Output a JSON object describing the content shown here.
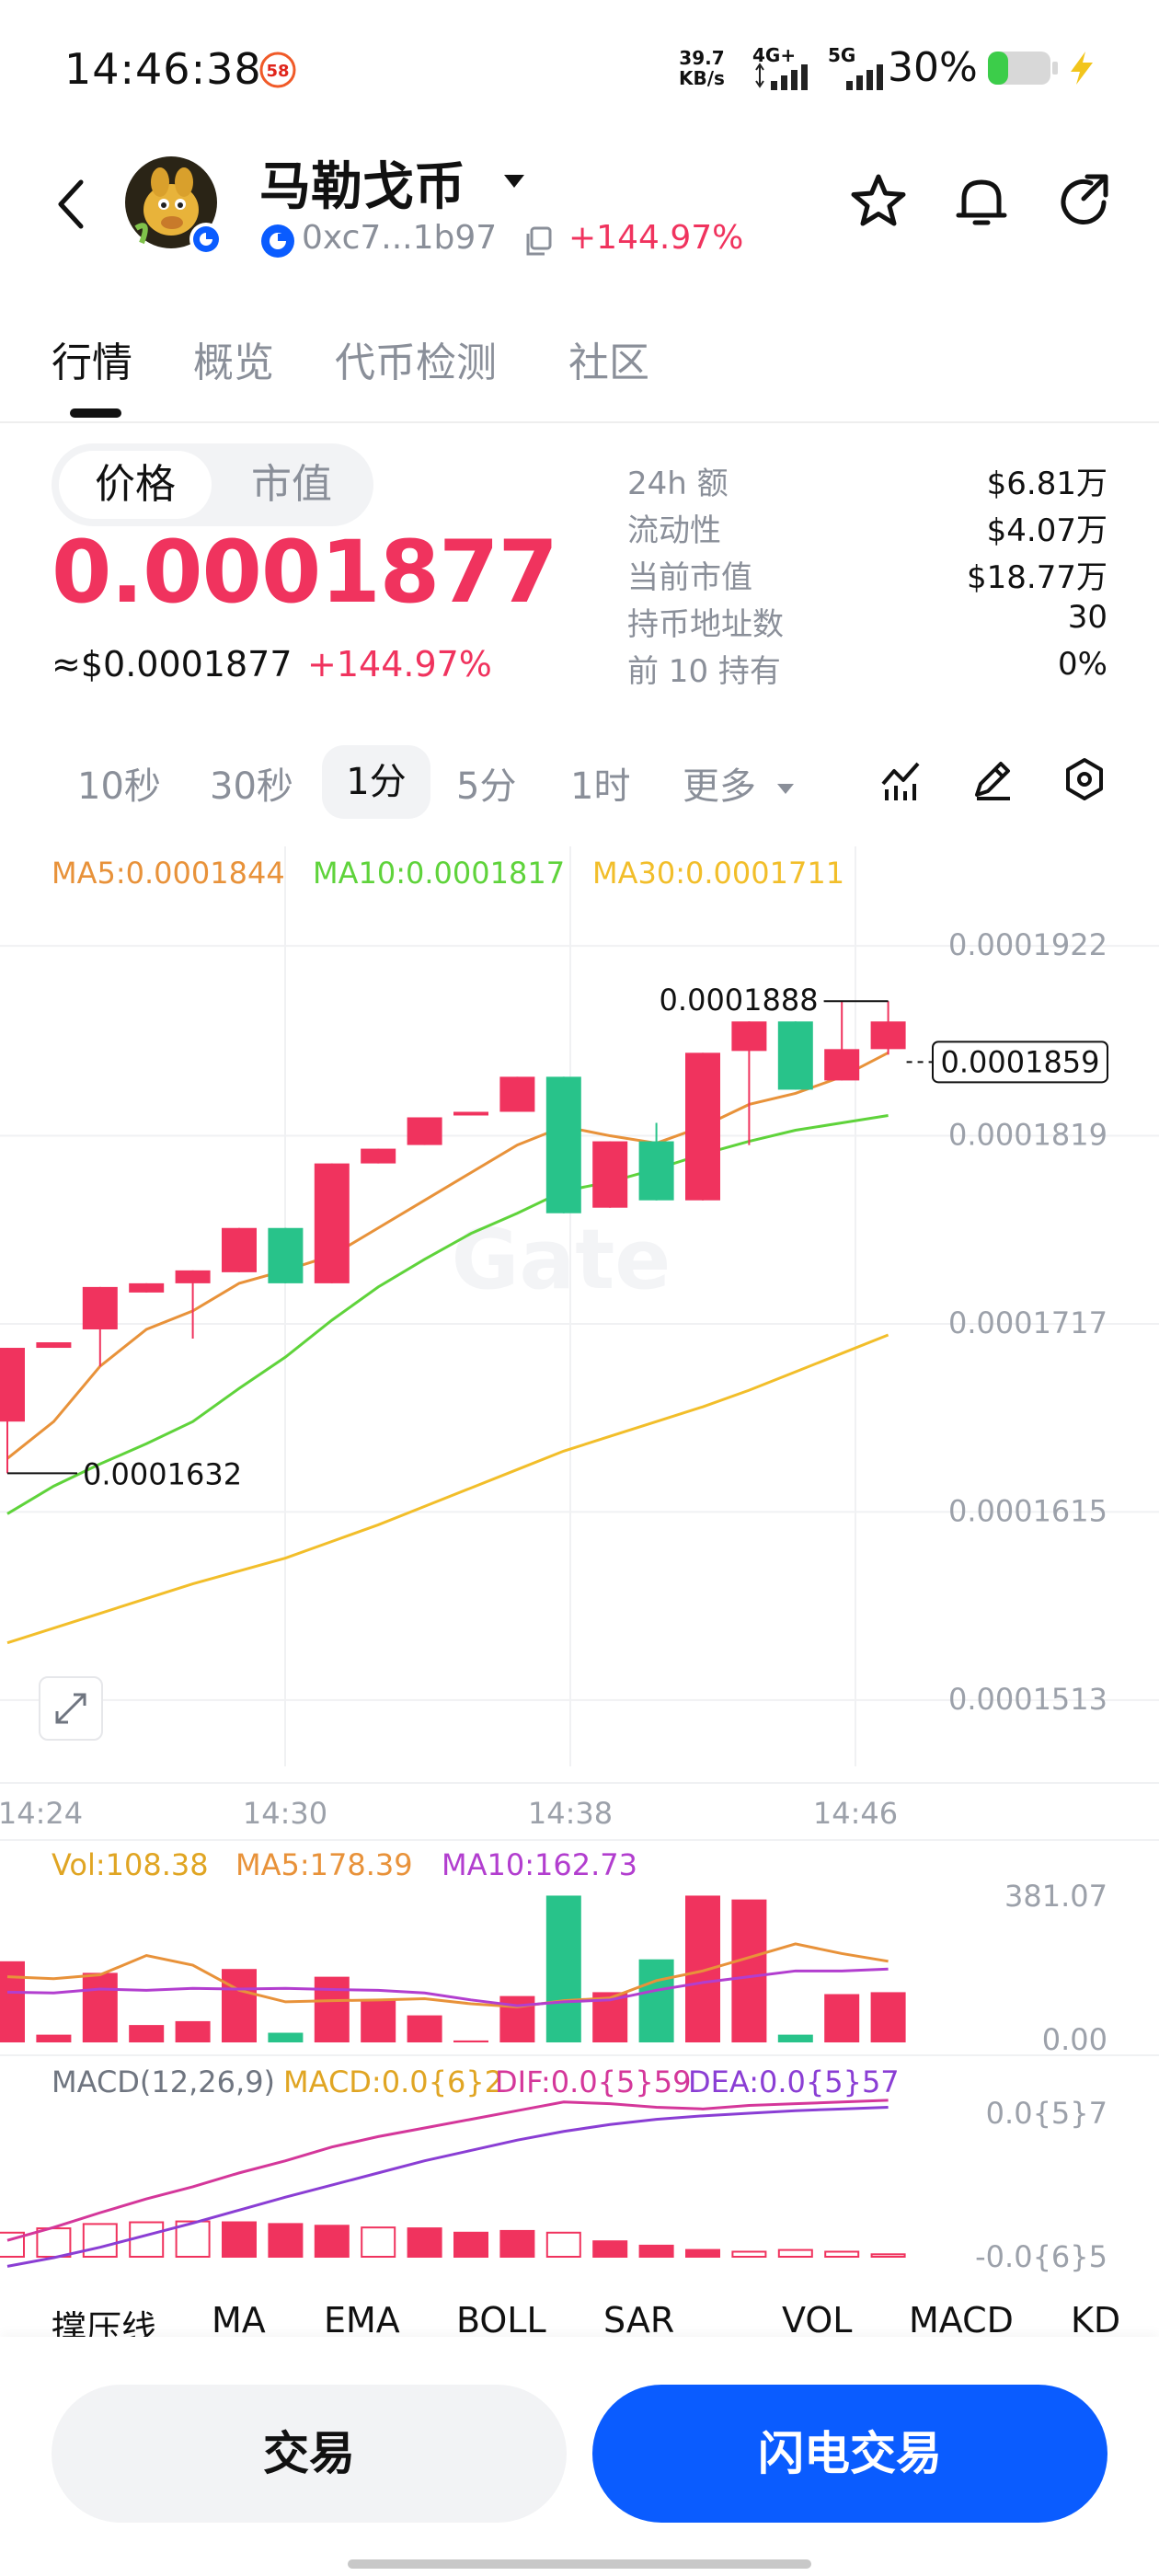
{
  "status_bar": {
    "time": "14:46:38",
    "notification_badge": "58",
    "net_speed_value": "39.7",
    "net_speed_unit": "KB/s",
    "network_1": "4G+",
    "network_2": "5G",
    "battery_percent": "30%"
  },
  "header": {
    "token_name": "马勒戈币",
    "contract_address": "0xc7...1b97",
    "change_percent": "+144.97%"
  },
  "tabs": [
    {
      "label": "行情",
      "active": true
    },
    {
      "label": "概览",
      "active": false
    },
    {
      "label": "代币检测",
      "active": false
    },
    {
      "label": "社区",
      "active": false
    }
  ],
  "price_panel": {
    "toggle_price": "价格",
    "toggle_mcap": "市值",
    "price": "0.0001877",
    "usd_price": "≈$0.0001877",
    "usd_change": "+144.97%"
  },
  "stats": [
    {
      "label": "24h  额",
      "value": "$6.81万"
    },
    {
      "label": "流动性",
      "value": "$4.07万"
    },
    {
      "label": "当前市值",
      "value": "$18.77万"
    },
    {
      "label": "持币地址数",
      "value": "30"
    },
    {
      "label": "前 10 持有",
      "value": "0%"
    }
  ],
  "intervals": [
    {
      "label": "10秒",
      "active": false
    },
    {
      "label": "30秒",
      "active": false
    },
    {
      "label": "1分",
      "active": true
    },
    {
      "label": "5分",
      "active": false
    },
    {
      "label": "1时",
      "active": false
    }
  ],
  "more_label": "更多",
  "chart_data": {
    "type": "candlestick",
    "ma_legend": {
      "ma5": "MA5:0.0001844",
      "ma10": "MA10:0.0001817",
      "ma30": "MA30:0.0001711"
    },
    "y_ticks": [
      "0.0001922",
      "0.0001819",
      "0.0001717",
      "0.0001615",
      "0.0001513"
    ],
    "y_tick_values": [
      0.0001922,
      0.0001819,
      0.0001717,
      0.0001615,
      0.0001513
    ],
    "x_ticks": [
      "14:24",
      "14:30",
      "14:38",
      "14:46"
    ],
    "high_label": "0.0001888",
    "low_label": "0.0001632",
    "current_price_label": "0.0001859",
    "candles": [
      {
        "o": 0.000166,
        "c": 0.00017,
        "h": 0.00017,
        "l": 0.0001632
      },
      {
        "o": 0.00017,
        "c": 0.0001703,
        "h": 0.0001703,
        "l": 0.00017
      },
      {
        "o": 0.000171,
        "c": 0.0001733,
        "h": 0.0001733,
        "l": 0.000169
      },
      {
        "o": 0.000173,
        "c": 0.0001735,
        "h": 0.0001735,
        "l": 0.000173
      },
      {
        "o": 0.0001735,
        "c": 0.0001742,
        "h": 0.0001742,
        "l": 0.0001705
      },
      {
        "o": 0.0001741,
        "c": 0.0001765,
        "h": 0.0001765,
        "l": 0.0001741
      },
      {
        "o": 0.0001765,
        "c": 0.0001735,
        "h": 0.0001765,
        "l": 0.0001735
      },
      {
        "o": 0.0001735,
        "c": 0.00018,
        "h": 0.00018,
        "l": 0.0001735
      },
      {
        "o": 0.00018,
        "c": 0.0001808,
        "h": 0.0001808,
        "l": 0.00018
      },
      {
        "o": 0.000181,
        "c": 0.0001825,
        "h": 0.0001825,
        "l": 0.000181
      },
      {
        "o": 0.0001826,
        "c": 0.0001828,
        "h": 0.0001828,
        "l": 0.0001826
      },
      {
        "o": 0.0001828,
        "c": 0.0001847,
        "h": 0.0001847,
        "l": 0.0001828
      },
      {
        "o": 0.0001847,
        "c": 0.0001773,
        "h": 0.0001847,
        "l": 0.0001773
      },
      {
        "o": 0.0001776,
        "c": 0.0001812,
        "h": 0.0001812,
        "l": 0.0001776
      },
      {
        "o": 0.0001812,
        "c": 0.000178,
        "h": 0.0001822,
        "l": 0.000178
      },
      {
        "o": 0.000178,
        "c": 0.000186,
        "h": 0.000186,
        "l": 0.000178
      },
      {
        "o": 0.0001861,
        "c": 0.0001877,
        "h": 0.0001877,
        "l": 0.000181
      },
      {
        "o": 0.0001877,
        "c": 0.000184,
        "h": 0.0001877,
        "l": 0.000184
      },
      {
        "o": 0.0001845,
        "c": 0.0001862,
        "h": 0.0001888,
        "l": 0.0001845
      },
      {
        "o": 0.0001862,
        "c": 0.0001877,
        "h": 0.0001888,
        "l": 0.0001859
      }
    ],
    "ma5_series": [
      0.000164,
      0.000166,
      0.000169,
      0.000171,
      0.000172,
      0.0001735,
      0.0001742,
      0.000175,
      0.0001765,
      0.000178,
      0.0001795,
      0.000181,
      0.000182,
      0.0001815,
      0.0001811,
      0.000182,
      0.0001832,
      0.0001838,
      0.0001847,
      0.000186
    ],
    "ma10_series": [
      0.000161,
      0.0001625,
      0.0001637,
      0.0001648,
      0.000166,
      0.0001678,
      0.0001695,
      0.0001715,
      0.0001733,
      0.0001748,
      0.0001762,
      0.0001773,
      0.0001785,
      0.000179,
      0.0001797,
      0.0001805,
      0.0001812,
      0.0001818,
      0.0001822,
      0.0001826
    ],
    "ma30_series": [
      0.000154,
      0.0001548,
      0.0001556,
      0.0001564,
      0.0001572,
      0.0001579,
      0.0001586,
      0.0001595,
      0.0001604,
      0.0001614,
      0.0001624,
      0.0001634,
      0.0001644,
      0.0001652,
      0.000166,
      0.0001668,
      0.0001677,
      0.0001687,
      0.0001697,
      0.0001707
    ],
    "volume_legend": {
      "vol": "Vol:108.38",
      "ma5": "MA5:178.39",
      "ma10": "MA10:162.73"
    },
    "volume_ticks": [
      "381.07",
      "0.00"
    ],
    "volume_max": 381.07,
    "volumes": [
      210,
      20,
      180,
      45,
      55,
      190,
      25,
      170,
      110,
      70,
      5,
      120,
      380,
      130,
      215,
      380,
      370,
      20,
      125,
      130
    ],
    "volume_ma5": [
      170,
      165,
      175,
      225,
      200,
      135,
      105,
      108,
      110,
      113,
      100,
      92,
      108,
      115,
      160,
      185,
      220,
      255,
      230,
      210
    ],
    "volume_ma10": [
      130,
      128,
      138,
      135,
      140,
      138,
      140,
      137,
      135,
      128,
      110,
      95,
      105,
      110,
      135,
      155,
      170,
      185,
      185,
      190
    ],
    "macd_legend": {
      "title": "MACD(12,26,9)",
      "macd": "MACD:0.0{6}2",
      "dif": "DIF:0.0{5}59",
      "dea": "DEA:0.0{5}57"
    },
    "macd_ticks": [
      "0.0{5}7",
      "-0.0{6}5"
    ],
    "macd_hist": [
      -0.3,
      -0.35,
      -0.4,
      -0.42,
      -0.43,
      -0.42,
      -0.4,
      -0.38,
      -0.36,
      -0.35,
      -0.3,
      -0.32,
      -0.3,
      -0.2,
      -0.15,
      -0.1,
      -0.08,
      -0.1,
      -0.08,
      -0.05
    ],
    "dif_series": [
      0.2,
      0.35,
      0.52,
      0.68,
      0.82,
      0.98,
      1.12,
      1.28,
      1.4,
      1.5,
      1.6,
      1.7,
      1.8,
      1.78,
      1.74,
      1.72,
      1.76,
      1.78,
      1.8,
      1.82
    ],
    "dea_series": [
      -0.1,
      0.0,
      0.12,
      0.26,
      0.4,
      0.55,
      0.7,
      0.84,
      0.98,
      1.12,
      1.24,
      1.36,
      1.46,
      1.54,
      1.6,
      1.64,
      1.67,
      1.7,
      1.72,
      1.74
    ]
  },
  "indicator_toolbar": [
    "撑压线",
    "MA",
    "EMA",
    "BOLL",
    "SAR",
    "VOL",
    "MACD",
    "KD"
  ],
  "actions": {
    "trade": "交易",
    "flash_trade": "闪电交易"
  },
  "colors": {
    "up": "#f0335e",
    "down": "#28c38a",
    "ma5": "#e8923a",
    "ma10": "#5fd33b",
    "ma30": "#f2be2a",
    "vol_ma10": "#b23ecf",
    "dif": "#d4379a",
    "dea": "#8a3ed4",
    "primary": "#0a5cff"
  }
}
